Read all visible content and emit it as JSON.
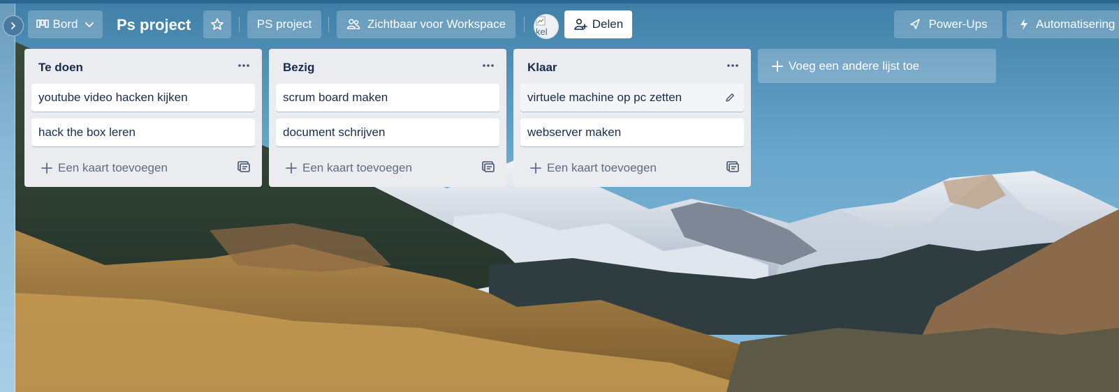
{
  "header": {
    "view_label": "Bord",
    "board_title": "Ps project",
    "workspace_label": "PS project",
    "visibility_label": "Zichtbaar voor Workspace",
    "avatar_alt": "kel",
    "share_label": "Delen",
    "powerups_label": "Power-Ups",
    "automation_label": "Automatisering"
  },
  "lists": [
    {
      "title": "Te doen",
      "cards": [
        "youtube video hacken kijken",
        "hack the box leren"
      ],
      "add_card_label": "Een kaart toevoegen"
    },
    {
      "title": "Bezig",
      "cards": [
        "scrum board maken",
        "document schrijven"
      ],
      "add_card_label": "Een kaart toevoegen"
    },
    {
      "title": "Klaar",
      "cards": [
        "virtuele machine op pc zetten",
        "webserver maken"
      ],
      "add_card_label": "Een kaart toevoegen"
    }
  ],
  "add_list_label": "Voeg een andere lijst toe",
  "icons": {
    "expand": "chevron-right-icon",
    "view": "board-icon",
    "view_toggle": "chevron-down-icon",
    "star": "star-icon",
    "visibility": "people-icon",
    "share": "add-user-icon",
    "powerups": "rocket-icon",
    "automation": "bolt-icon",
    "list_menu": "more-horizontal-icon",
    "add": "plus-icon",
    "template": "card-template-icon",
    "edit": "pencil-icon"
  },
  "colors": {
    "sky": "#4f8fb3",
    "list_bg": "#ebecf0",
    "text": "#172b4d",
    "muted": "#5e6c84"
  }
}
